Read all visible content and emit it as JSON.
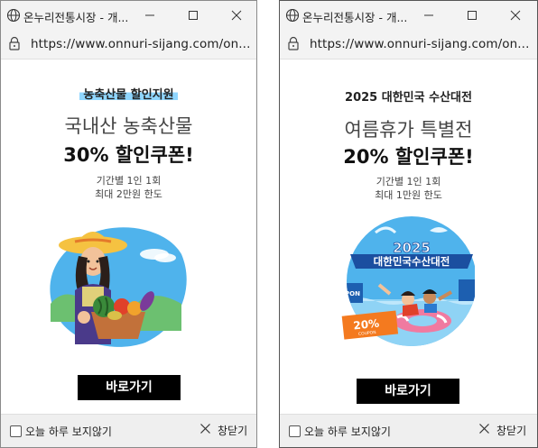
{
  "windows": [
    {
      "title": "온누리전통시장 - 개...",
      "url": "https://www.onnuri-sijang.com/on...",
      "tag": "농축산물 할인지원",
      "headline": "국내산 농축산물",
      "bigline": "30% 할인쿠폰!",
      "detail1": "기간별 1인 1회",
      "detail2": "최대 2만원 한도",
      "cta": "바로가기",
      "footer_checkbox": "오늘 하루 보지않기",
      "footer_close": "창닫기",
      "illustration": "farmer-with-vegetables"
    },
    {
      "title": "온누리전통시장 - 개...",
      "url": "https://www.onnuri-sijang.com/on...",
      "tag": "2025 대한민국 수산대전",
      "headline": "여름휴가 특별전",
      "bigline": "20% 할인쿠폰!",
      "detail1": "기간별 1인 1회",
      "detail2": "최대 1만원 한도",
      "cta": "바로가기",
      "footer_checkbox": "오늘 하루 보지않기",
      "footer_close": "창닫기",
      "illustration": "seafood-festival-swimmers",
      "badge_year": "2025",
      "badge_name": "대한민국수산대전",
      "coupon_value": "20%",
      "coupon_label": "COUPON",
      "side_text": "PON"
    }
  ],
  "colors": {
    "tag_highlight": "#8fd6ff",
    "cta_bg": "#000000",
    "sky_blue": "#4fb3ec",
    "coupon_orange": "#f47a1f"
  }
}
